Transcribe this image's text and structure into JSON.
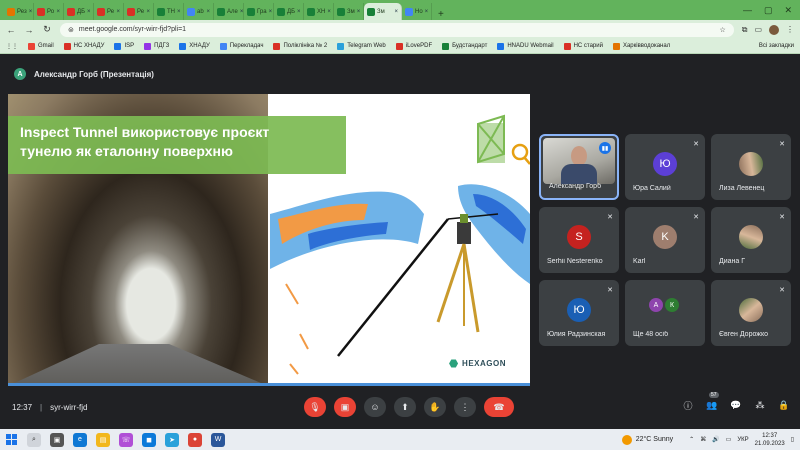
{
  "browser": {
    "tabs": [
      {
        "label": "Рез",
        "fav": "#e37400"
      },
      {
        "label": "Ро",
        "fav": "#d93025"
      },
      {
        "label": "ДБ",
        "fav": "#d93025"
      },
      {
        "label": "Ре",
        "fav": "#d93025"
      },
      {
        "label": "Ре",
        "fav": "#d93025"
      },
      {
        "label": "ТН",
        "fav": "#188038"
      },
      {
        "label": "ab",
        "fav": "#4285f4"
      },
      {
        "label": "Але",
        "fav": "#188038"
      },
      {
        "label": "Гра",
        "fav": "#188038"
      },
      {
        "label": "ДБ",
        "fav": "#188038"
      },
      {
        "label": "ХН",
        "fav": "#188038"
      },
      {
        "label": "Зм",
        "fav": "#188038"
      },
      {
        "label": "Зм",
        "fav": "#188038",
        "active": true
      },
      {
        "label": "Но",
        "fav": "#4285f4"
      }
    ],
    "url": "meet.google.com/syr-wirr-fjd?pli=1",
    "bookmarks": [
      {
        "label": "Gmail",
        "color": "#ea4335"
      },
      {
        "label": "НС ХНАДУ",
        "color": "#d93025"
      },
      {
        "label": "ISP",
        "color": "#1a73e8"
      },
      {
        "label": "ПДГЗ",
        "color": "#9334e6"
      },
      {
        "label": "ХНАДУ",
        "color": "#1a73e8"
      },
      {
        "label": "Перекладач",
        "color": "#4285f4"
      },
      {
        "label": "Поліклініка № 2",
        "color": "#d93025"
      },
      {
        "label": "Telegram Web",
        "color": "#2aa1da"
      },
      {
        "label": "iLovePDF",
        "color": "#d93025"
      },
      {
        "label": "Будстандарт",
        "color": "#188038"
      },
      {
        "label": "HNADU Webmail",
        "color": "#1a73e8"
      },
      {
        "label": "НС старий",
        "color": "#d93025"
      },
      {
        "label": "Харківводоканал",
        "color": "#e37400"
      }
    ],
    "bookmarks_all": "Всі закладки"
  },
  "meet": {
    "presenter_initial": "А",
    "presenter_label": "Александр Горб (Презентація)",
    "slide": {
      "headline_line1": "Inspect Tunnel використовує проєкт",
      "headline_line2": "тунелю як еталонну поверхню",
      "logo": "HEXAGON"
    },
    "participants": [
      {
        "name": "Александр Горб",
        "type": "camera",
        "speaking": true
      },
      {
        "name": "Юра Салий",
        "initial": "Ю",
        "color": "#5c3fd6"
      },
      {
        "name": "Лиза Левенец",
        "type": "photo"
      },
      {
        "name": "Serhii Nesterenko",
        "initial": "S",
        "color": "#c5221f"
      },
      {
        "name": "Karl",
        "initial": "K",
        "color": "#9e7e6e"
      },
      {
        "name": "Диана Г",
        "type": "photo"
      },
      {
        "name": "Юлия Радзинская",
        "initial": "Ю",
        "color": "#1a5fb4"
      },
      {
        "name": "Ще 48 осіб",
        "pair": [
          "А",
          "К"
        ],
        "pair_colors": [
          "#8e44ad",
          "#2e7d32"
        ]
      },
      {
        "name": "Євген Дорожко",
        "type": "photo"
      }
    ],
    "time": "12:37",
    "code": "syr-wirr-fjd",
    "participant_count": "57"
  },
  "taskbar": {
    "weather": "22°C  Sunny",
    "lang": "УКР",
    "time": "12:37",
    "date": "21.09.2023"
  }
}
